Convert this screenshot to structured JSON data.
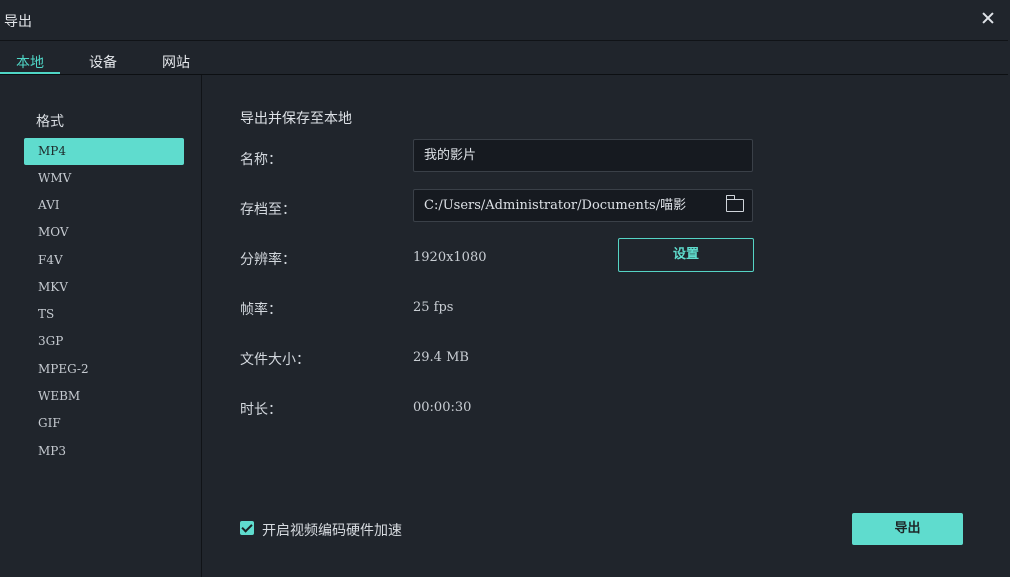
{
  "window": {
    "title": "导出"
  },
  "tabs": [
    {
      "label": "本地",
      "active": true
    },
    {
      "label": "设备",
      "active": false
    },
    {
      "label": "网站",
      "active": false
    }
  ],
  "sidebar": {
    "heading": "格式",
    "formats": [
      "MP4",
      "WMV",
      "AVI",
      "MOV",
      "F4V",
      "MKV",
      "TS",
      "3GP",
      "MPEG-2",
      "WEBM",
      "GIF",
      "MP3"
    ],
    "selected": "MP4"
  },
  "main": {
    "heading": "导出并保存至本地",
    "name": {
      "label": "名称：",
      "value": "我的影片"
    },
    "save_to": {
      "label": "存档至：",
      "value": "C:/Users/Administrator/Documents/喵影"
    },
    "resolution": {
      "label": "分辨率：",
      "value": "1920x1080",
      "settings_button": "设置"
    },
    "frame_rate": {
      "label": "帧率：",
      "value": "25 fps"
    },
    "file_size": {
      "label": "文件大小：",
      "value": "29.4 MB"
    },
    "duration": {
      "label": "时长：",
      "value": "00:00:30"
    }
  },
  "footer": {
    "hw_accel": {
      "label": "开启视频编码硬件加速",
      "checked": true
    },
    "export_button": "导出"
  },
  "colors": {
    "accent": "#5fdcce",
    "background": "#20252c",
    "input_bg": "#161a20"
  }
}
